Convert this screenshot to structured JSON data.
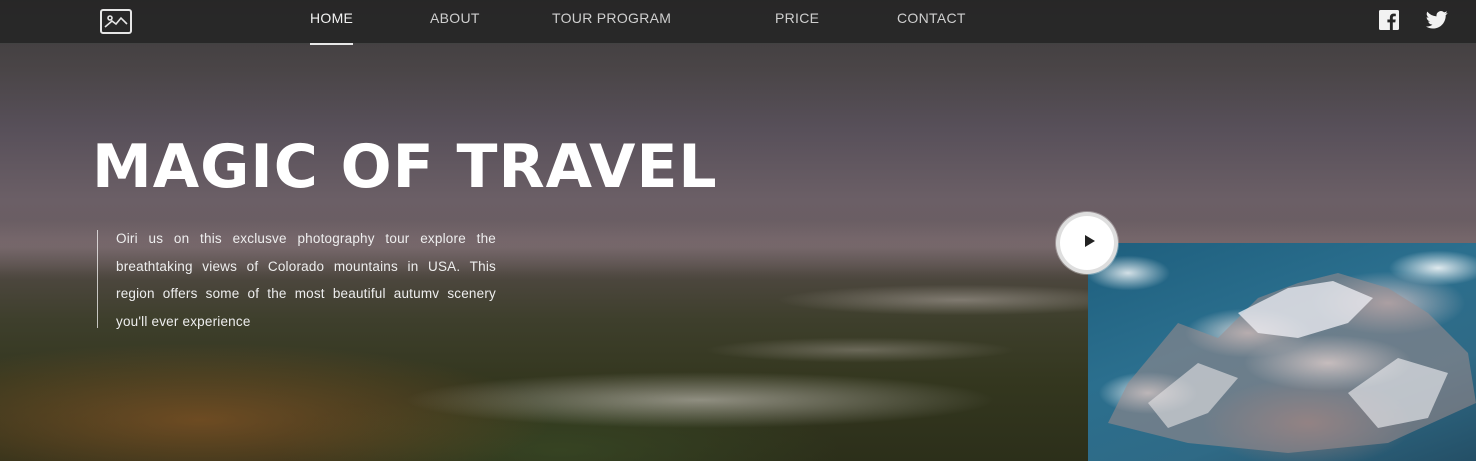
{
  "nav": {
    "items": [
      {
        "label": "HOME",
        "active": true
      },
      {
        "label": "ABOUT"
      },
      {
        "label": "TOUR PROGRAM"
      },
      {
        "label": "PRICE"
      },
      {
        "label": "CONTACT"
      }
    ],
    "logo_icon": "image-icon",
    "social": [
      "facebook-icon",
      "twitter-icon"
    ]
  },
  "hero": {
    "title": "MAGIC OF TRAVEL",
    "description": "Oiri us on this exclusve photography tour explore the breathtaking views of Colorado mountains in USA. This region offers some of the most beautiful autumv scenery you'll ever experience"
  },
  "video": {
    "play_icon": "play-icon"
  },
  "colors": {
    "nav_bg": "#262626",
    "text": "#ffffff",
    "nav_text": "#cfcfcf"
  }
}
